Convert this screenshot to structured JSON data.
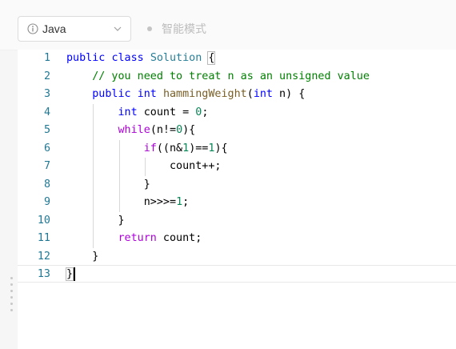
{
  "toolbar": {
    "language": "Java",
    "mode_label": "智能模式"
  },
  "colors": {
    "keyword": "#0000ff",
    "control": "#af00db",
    "type": "#267f99",
    "function": "#795e26",
    "comment": "#008000",
    "number": "#098658",
    "line_number": "#237893",
    "accent": "#f5a623"
  },
  "editor": {
    "line_numbers": [
      "1",
      "2",
      "3",
      "4",
      "5",
      "6",
      "7",
      "8",
      "9",
      "10",
      "11",
      "12",
      "13"
    ],
    "lines": [
      {
        "indent": 0,
        "tokens": [
          {
            "t": "public",
            "c": "kw"
          },
          {
            "t": " "
          },
          {
            "t": "class",
            "c": "kw"
          },
          {
            "t": " "
          },
          {
            "t": "Solution",
            "c": "ty"
          },
          {
            "t": " "
          },
          {
            "t": "{",
            "c": "bm"
          }
        ]
      },
      {
        "indent": 1,
        "tokens": [
          {
            "t": "// you need to treat n as an unsigned value",
            "c": "cm"
          }
        ]
      },
      {
        "indent": 1,
        "tokens": [
          {
            "t": "public",
            "c": "kw"
          },
          {
            "t": " "
          },
          {
            "t": "int",
            "c": "kw"
          },
          {
            "t": " "
          },
          {
            "t": "hammingWeight",
            "c": "fn"
          },
          {
            "t": "("
          },
          {
            "t": "int",
            "c": "kw"
          },
          {
            "t": " n) {"
          }
        ]
      },
      {
        "indent": 2,
        "tokens": [
          {
            "t": "int",
            "c": "kw"
          },
          {
            "t": " count = "
          },
          {
            "t": "0",
            "c": "num"
          },
          {
            "t": ";"
          }
        ]
      },
      {
        "indent": 2,
        "tokens": [
          {
            "t": "while",
            "c": "ctl"
          },
          {
            "t": "(n!="
          },
          {
            "t": "0",
            "c": "num"
          },
          {
            "t": "){"
          }
        ]
      },
      {
        "indent": 3,
        "tokens": [
          {
            "t": "if",
            "c": "ctl"
          },
          {
            "t": "((n&"
          },
          {
            "t": "1",
            "c": "num"
          },
          {
            "t": ")=="
          },
          {
            "t": "1",
            "c": "num"
          },
          {
            "t": "){"
          }
        ]
      },
      {
        "indent": 4,
        "tokens": [
          {
            "t": "count++;"
          }
        ]
      },
      {
        "indent": 3,
        "tokens": [
          {
            "t": "}"
          }
        ]
      },
      {
        "indent": 3,
        "tokens": [
          {
            "t": "n>>>="
          },
          {
            "t": "1",
            "c": "num"
          },
          {
            "t": ";"
          }
        ]
      },
      {
        "indent": 2,
        "tokens": [
          {
            "t": "}"
          }
        ]
      },
      {
        "indent": 2,
        "tokens": [
          {
            "t": "return",
            "c": "ctl"
          },
          {
            "t": " count;"
          }
        ]
      },
      {
        "indent": 1,
        "tokens": [
          {
            "t": "}"
          }
        ]
      },
      {
        "indent": 0,
        "tokens": [
          {
            "t": "}",
            "c": "bm"
          }
        ],
        "cursor": true
      }
    ]
  }
}
